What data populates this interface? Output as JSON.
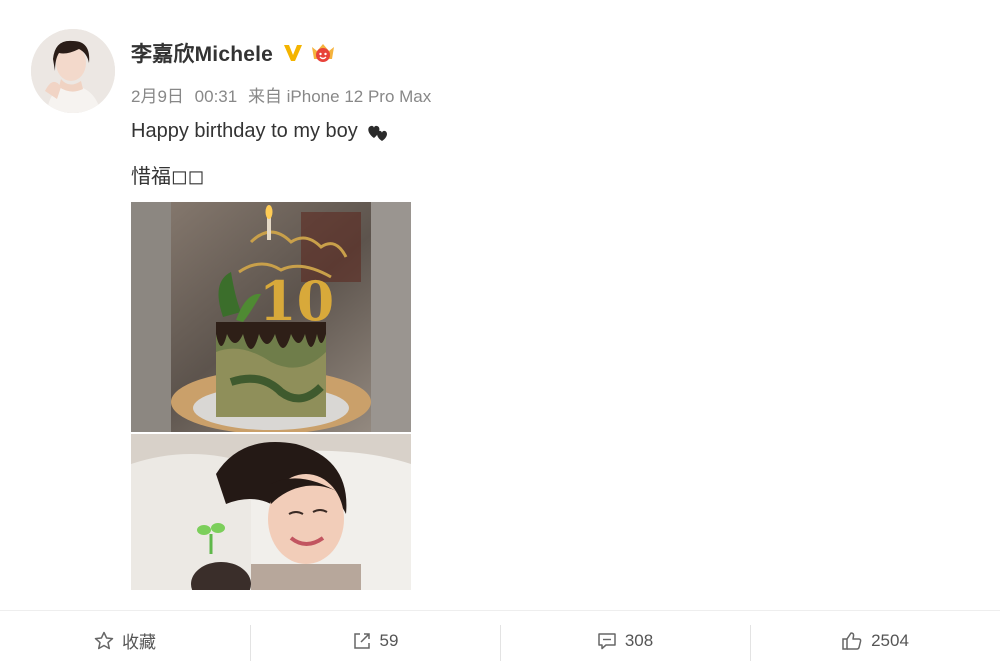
{
  "post": {
    "username": "李嘉欣Michele",
    "date": "2月9日",
    "time": "00:31",
    "source": "来自 iPhone 12 Pro Max",
    "text_line1": "Happy birthday to my boy",
    "text_line2": "惜福◻◻"
  },
  "images": [
    {
      "name": "cake-photo",
      "cake_number": "10"
    },
    {
      "name": "mother-baby-photo"
    }
  ],
  "actions": {
    "favorite_label": "收藏",
    "repost_count": "59",
    "comment_count": "308",
    "like_count": "2504"
  },
  "icons": {
    "verified": "verified-v-icon",
    "member": "member-badge-icon",
    "hearts": "two-hearts-emoji",
    "favorite": "star-icon",
    "repost": "repost-icon",
    "comment": "comment-icon",
    "like": "thumbs-up-icon"
  },
  "colors": {
    "verified": "#f4b400",
    "member_badge": "#e8423a",
    "meta_text": "#888888",
    "icon": "#666666"
  }
}
